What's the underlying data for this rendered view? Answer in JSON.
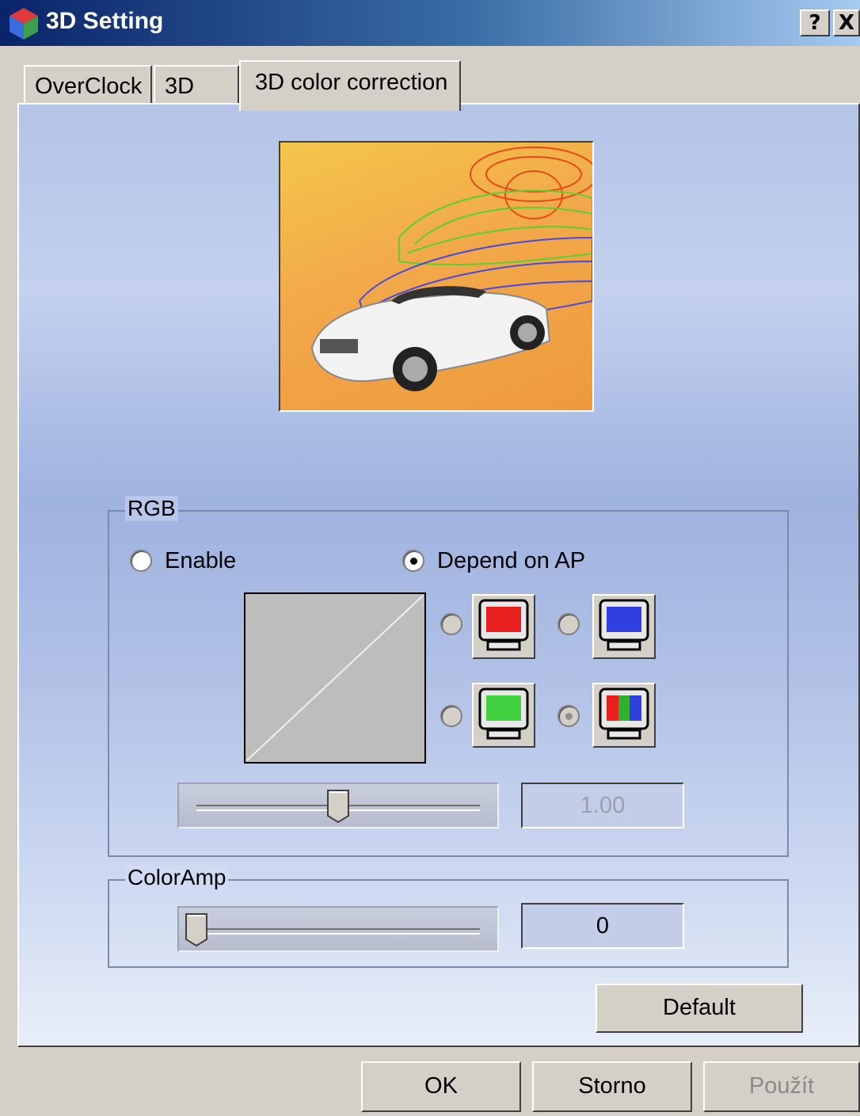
{
  "window": {
    "title": "3D Setting",
    "help_label": "?",
    "close_label": "X"
  },
  "tabs": [
    {
      "label": "OverClock",
      "active": false
    },
    {
      "label": "3D",
      "active": false
    },
    {
      "label": "3D color correction",
      "active": true
    }
  ],
  "preview": {
    "description_icon": "car-wireframe-preview-image"
  },
  "rgb_group": {
    "label": "RGB",
    "enable_label": "Enable",
    "enable_selected": false,
    "depend_label": "Depend on AP",
    "depend_selected": true,
    "channels": [
      {
        "name": "red-channel",
        "icon": "red-monitor-icon",
        "selected": false
      },
      {
        "name": "blue-channel",
        "icon": "blue-monitor-icon",
        "selected": false
      },
      {
        "name": "green-channel",
        "icon": "green-monitor-icon",
        "selected": false
      },
      {
        "name": "all-channels",
        "icon": "rgb-monitor-icon",
        "selected": true
      }
    ],
    "gamma_value": "1.00",
    "gamma_slider_fraction": 0.5
  },
  "coloramp_group": {
    "label": "ColorAmp",
    "value": "0",
    "slider_fraction": 0.0
  },
  "buttons": {
    "default_label": "Default",
    "ok_label": "OK",
    "cancel_label": "Storno",
    "apply_label": "Použít"
  },
  "colors": {
    "title_start": "#0a246a",
    "title_end": "#a6caf0",
    "face": "#d4d0c8"
  }
}
